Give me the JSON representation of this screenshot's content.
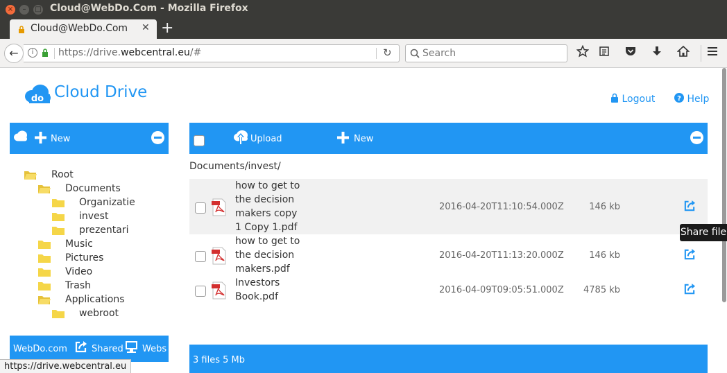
{
  "window": {
    "title": "Cloud@WebDo.Com - Mozilla Firefox",
    "close": "×",
    "minimize": "–",
    "maximize": "□"
  },
  "tab": {
    "title": "Cloud@WebDo.Com",
    "close": "✕",
    "new_tab": "+"
  },
  "nav": {
    "back": "←",
    "url_prefix": "https://drive.",
    "url_domain": "webcentral.eu",
    "url_suffix": "/#",
    "search_placeholder": "Search",
    "info": "i",
    "reload": "↻"
  },
  "toolbar_icons": [
    "star-icon",
    "reader-icon",
    "pocket-icon",
    "download-icon",
    "home-icon",
    "menu-icon"
  ],
  "header": {
    "logo_mark": "do",
    "brand": "Cloud Drive",
    "logout": "Logout",
    "help": "Help",
    "help_mark": "?"
  },
  "left_panel": {
    "new_label": "New",
    "tree": [
      {
        "label": "Root",
        "level": 0,
        "open": true
      },
      {
        "label": "Documents",
        "level": 1,
        "open": true
      },
      {
        "label": "Organizatie",
        "level": 2,
        "open": false
      },
      {
        "label": "invest",
        "level": 2,
        "open": false
      },
      {
        "label": "prezentari",
        "level": 2,
        "open": false
      },
      {
        "label": "Music",
        "level": 1,
        "open": false
      },
      {
        "label": "Pictures",
        "level": 1,
        "open": false
      },
      {
        "label": "Video",
        "level": 1,
        "open": false
      },
      {
        "label": "Trash",
        "level": 1,
        "open": false
      },
      {
        "label": "Applications",
        "level": 1,
        "open": true
      },
      {
        "label": "webroot",
        "level": 2,
        "open": false
      }
    ],
    "footer": {
      "site": "WebDo.com",
      "shared": "Shared",
      "webs": "Webs"
    }
  },
  "main": {
    "upload_label": "Upload",
    "new_label": "New",
    "breadcrumb": "Documents/invest/",
    "files": [
      {
        "name_lines": [
          "how to get to",
          "the decision",
          "makers copy",
          "1 Copy 1.pdf"
        ],
        "date": "2016-04-20T11:10:54.000Z",
        "size": "146 kb",
        "highlighted": true
      },
      {
        "name_lines": [
          "how to get to",
          "the decision",
          "makers.pdf"
        ],
        "date": "2016-04-20T11:13:20.000Z",
        "size": "146 kb",
        "highlighted": false
      },
      {
        "name_lines": [
          "Investors",
          "Book.pdf"
        ],
        "date": "2016-04-09T09:05:51.000Z",
        "size": "4785 kb",
        "highlighted": false
      }
    ],
    "footer_summary": "3 files 5 Mb",
    "tooltip": "Share file"
  },
  "status_url": "https://drive.webcentral.eu",
  "colors": {
    "accent": "#2196f3",
    "folder": "#f5d648",
    "pdf": "#d32f2f"
  }
}
